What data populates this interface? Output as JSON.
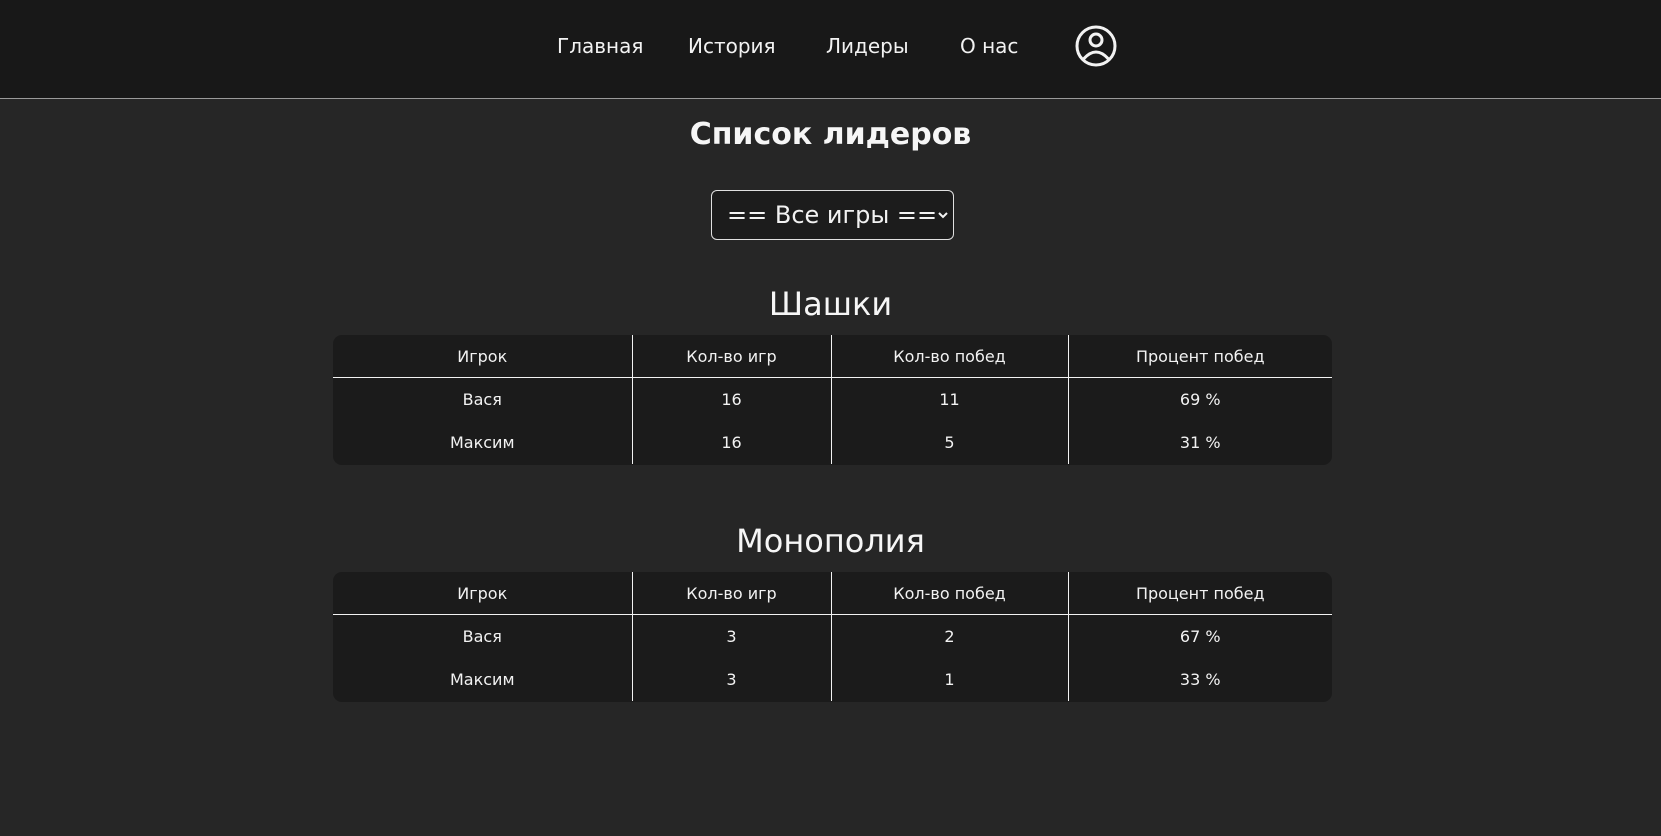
{
  "nav": {
    "items": [
      "Главная",
      "История",
      "Лидеры",
      "О нас"
    ]
  },
  "profile_icon": "user-circle-icon",
  "page_title": "Список лидеров",
  "game_select": {
    "selected": "== Все игры =="
  },
  "columns": [
    "Игрок",
    "Кол-во игр",
    "Кол-во побед",
    "Процент побед"
  ],
  "games": [
    {
      "title": "Шашки",
      "rows": [
        [
          "Вася",
          "16",
          "11",
          "69 %"
        ],
        [
          "Максим",
          "16",
          "5",
          "31 %"
        ]
      ]
    },
    {
      "title": "Монополия",
      "rows": [
        [
          "Вася",
          "3",
          "2",
          "67 %"
        ],
        [
          "Максим",
          "3",
          "1",
          "33 %"
        ]
      ]
    }
  ],
  "colors": {
    "page_background": "#262626",
    "header_background": "#181818",
    "table_background": "#1b1b1b",
    "text": "#f2f2f2"
  }
}
